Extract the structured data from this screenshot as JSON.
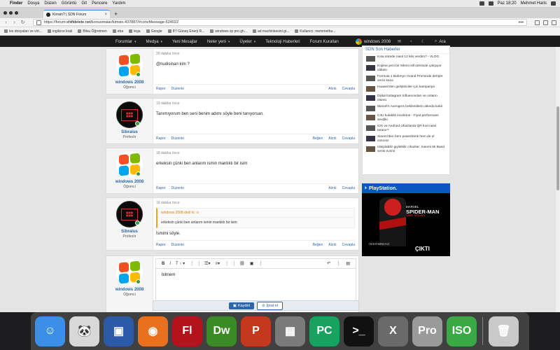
{
  "menubar": {
    "app": "Finder",
    "items": [
      "Dosya",
      "Düzen",
      "Görüntü",
      "Git",
      "Pencere",
      "Yardım"
    ],
    "clock": "Paz 18:20",
    "user": "Mehmet Haris"
  },
  "browser": {
    "tab_title": "Kimsin? | SDN Forum",
    "tab_close": "×",
    "new_tab": "+",
    "url_host": "https://forum.",
    "url_domain": "shiftdelete.net",
    "url_path": "/konusmalar/kimsin.437887/#convMessage-624022",
    "more": "•••",
    "bookmarks": [
      "les dosyaları ve virt...",
      "ingilizce krali",
      "Bilsu Öğretmen",
      "eba",
      "lega",
      "Google",
      "8°/ Güneş Enerji R...",
      "windows xp pro gh...",
      "ad machinkesini gi...",
      "Kullanıcı: memmetha..."
    ]
  },
  "forum_nav": {
    "items": [
      {
        "label": "Forumlar",
        "dropdown": true
      },
      {
        "label": "Medya",
        "dropdown": true
      },
      {
        "label": "Yeni Mesajlar",
        "dropdown": false
      },
      {
        "label": "Neler yeni",
        "dropdown": true
      },
      {
        "label": "Üyeler",
        "dropdown": true
      },
      {
        "label": "Teknoloji Haberleri",
        "dropdown": false
      },
      {
        "label": "Forum Kuralları",
        "dropdown": false
      }
    ],
    "user": "windows 2008",
    "search": "Ara"
  },
  "posts": [
    {
      "time": "20 dakika önce",
      "user": "windows 2008",
      "rank": "Öğrenci",
      "text": "@nudisinan kim ?",
      "report": "Rapor",
      "edit": "Düzenle",
      "like": "",
      "quote": "Alıntı",
      "reply": "Cevapla"
    },
    {
      "time": "19 dakika önce",
      "user": "Sibraius",
      "rank": "Profesör",
      "text": "Tanımıyorum ben seni benim adımı söyle beni tanıyorsan.",
      "report": "Rapor",
      "edit": "Düzenle",
      "like": "Beğen",
      "quote": "Alıntı",
      "reply": "Cevapla"
    },
    {
      "time": "18 dakika önce",
      "user": "windows 2008",
      "rank": "Öğrenci",
      "text": "erkeksin çünki ben anlarım ismin mantıklı bir isim",
      "report": "Rapor",
      "edit": "Düzenle",
      "like": "",
      "quote": "Alıntı",
      "reply": "Cevapla"
    },
    {
      "time": "18 dakika önce",
      "user": "Sibraius",
      "rank": "Profesör",
      "quote_header": "windows 2008 dedi ki: ⊙",
      "quote_body": "erkeksin çünki ben anlarım ismin mantıklı bir isim",
      "text": "İsmimi söyle.",
      "report": "Rapor",
      "edit": "Düzenle",
      "like": "Beğen",
      "quote": "Alıntı",
      "reply": "Cevapla"
    }
  ],
  "editor": {
    "user": "windows 2008",
    "rank": "Öğrenci",
    "content": "bilmem",
    "save": "Kaydet",
    "cancel": "İptal et"
  },
  "sidebar": {
    "heading": "SDN Son Haberler",
    "news": [
      "Kısa sürede nasıl 12 kilo verdim? - VLOG",
      "Kojima yeni bir Silent Hill üzerinde çalışıyor iddiası",
      "Formula 1 Bahreyn Grand Prix'sinde dehşet verici kaza",
      "Huawei'den geliştiriciler için kampanya",
      "Dijital İnstagram Influencerları ve onların ölümü",
      "Marvel's Avengers beklentilerin altında kaldı",
      "C4U kulaklık inceleme - Fiyat performans sevdiki",
      "iOS ve Android cihazlarda QR kod nasıl taranır?",
      "Xiaomi'den hem powerbank hem de el ısıtıcısı!",
      "Ulaşılabilir giyilebilir cihazlar: Xiaomi Mi Band serisi evrimi"
    ],
    "ad": {
      "brand": "PlayStation.",
      "title_marvel": "MARVEL",
      "title_main": "SPIDER-MAN",
      "title_sub": "Miles Morales",
      "studio": "INSOMNIAC",
      "cta": "ÇIKTI"
    }
  },
  "dock": [
    {
      "name": "finder",
      "label": "☺",
      "color": "#3b8fe6"
    },
    {
      "name": "panda",
      "label": "🐼",
      "color": "#d8d8d8"
    },
    {
      "name": "virtualbox",
      "label": "▣",
      "color": "#2d5aa8"
    },
    {
      "name": "firefox",
      "label": "◉",
      "color": "#e8701e"
    },
    {
      "name": "flash",
      "label": "Fl",
      "color": "#b3131b"
    },
    {
      "name": "dreamweaver",
      "label": "Dw",
      "color": "#3a8a25"
    },
    {
      "name": "powerpoint",
      "label": "P",
      "color": "#c4391d"
    },
    {
      "name": "app-manager",
      "label": "▦",
      "color": "#7a7a7a"
    },
    {
      "name": "pycharm",
      "label": "PC",
      "color": "#17a35f"
    },
    {
      "name": "terminal",
      "label": ">_",
      "color": "#111111"
    },
    {
      "name": "xquartz",
      "label": "X",
      "color": "#6a6a6a"
    },
    {
      "name": "disk-utility",
      "label": "Pro",
      "color": "#9a9a9a"
    },
    {
      "name": "iso-tool",
      "label": "ISO",
      "color": "#39a845"
    },
    {
      "name": "trash",
      "label": "🗑",
      "color": "#c9c9c9"
    }
  ],
  "colors": {
    "accent": "#2c66a8",
    "nav_bg": "#1c1c1c",
    "ps_blue": "#0b57c2",
    "quote_orange": "#e07b00"
  }
}
